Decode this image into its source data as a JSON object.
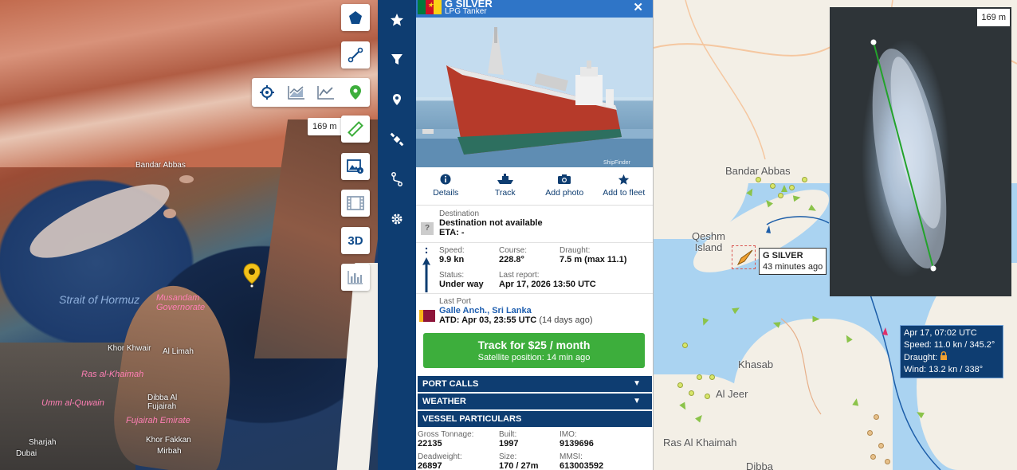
{
  "left_map": {
    "labels": {
      "bandar": "Bandar Abbas",
      "strait": "Strait of Hormuz",
      "musandam": "Musandam Governorate",
      "khor_khwair": "Khor Khwair",
      "al_limah": "Al Limah",
      "ras": "Ras al-Khaimah",
      "umm": "Umm al-Quwain",
      "dibba": "Dibba Al Fujairah",
      "fujairah": "Fujairah Emirate",
      "khorfakkan": "Khor Fakkan",
      "mirbah": "Mirbah",
      "sharjah": "Sharjah",
      "dubai": "Dubai"
    },
    "scale": "169 m",
    "icons": [
      "polygon-icon",
      "line-measure-icon",
      "crosshair-icon",
      "area-chart-icon",
      "line-chart-icon",
      "map-pin-icon",
      "ruler-icon",
      "image-info-icon",
      "film-icon",
      "chart-bars-icon"
    ],
    "btn_3d": "3D"
  },
  "vessel": {
    "name": "G SILVER",
    "type": "LPG Tanker",
    "flag_colors": [
      "#007a3d",
      "#ce1126",
      "#fcd116"
    ],
    "actions": [
      {
        "label": "Details"
      },
      {
        "label": "Track"
      },
      {
        "label": "Add photo"
      },
      {
        "label": "Add to fleet"
      }
    ],
    "destination": {
      "label": "Destination",
      "value": "Destination not available",
      "eta": "ETA: -"
    },
    "speed": {
      "label": "Speed:",
      "value": "9.9 kn"
    },
    "course": {
      "label": "Course:",
      "value": "228.8°"
    },
    "draught": {
      "label": "Draught:",
      "value": "7.5 m (max 11.1)"
    },
    "status": {
      "label": "Status:",
      "value": "Under way"
    },
    "last_report": {
      "label": "Last report:",
      "value": "Apr 17, 2026 13:50 UTC"
    },
    "last_port": {
      "label": "Last Port",
      "name": "Galle Anch., Sri Lanka",
      "atd": "ATD: Apr 03, 23:55 UTC",
      "ago": "(14 days ago)"
    },
    "track_button": {
      "title": "Track for $25 / month",
      "subtitle": "Satellite position: 14 min ago"
    },
    "sections": [
      "PORT CALLS",
      "WEATHER",
      "VESSEL PARTICULARS"
    ],
    "particulars": {
      "gross_tonnage": {
        "label": "Gross Tonnage:",
        "value": "22135"
      },
      "built": {
        "label": "Built:",
        "value": "1997"
      },
      "imo": {
        "label": "IMO:",
        "value": "9139696"
      },
      "deadweight": {
        "label": "Deadweight:",
        "value": "26897"
      },
      "size": {
        "label": "Size:",
        "value": "170 / 27m"
      },
      "mmsi": {
        "label": "MMSI:",
        "value": "613003592"
      }
    }
  },
  "right_map": {
    "labels": {
      "bandar": "Bandar Abbas",
      "qeshm": "Qeshm Island",
      "khasab": "Khasab",
      "aljeer": "Al Jeer",
      "ras": "Ras Al Khaimah",
      "dibba": "Dibba"
    },
    "callout": {
      "name": "G SILVER",
      "time": "43 minutes ago"
    },
    "track_point": {
      "time": "Apr 17, 07:02 UTC",
      "speed": "Speed: 11.0 kn / 345.2°",
      "draught": "Draught:",
      "wind": "Wind: 13.2 kn / 338°"
    },
    "zoom_scale": "169 m"
  }
}
